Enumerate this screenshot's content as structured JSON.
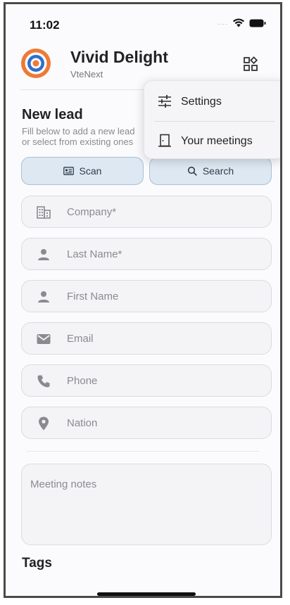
{
  "status_bar": {
    "time": "11:02",
    "signal": "....",
    "icons": [
      "wifi-icon",
      "battery-icon"
    ]
  },
  "header": {
    "title": "Vivid Delight",
    "subtitle": "VteNext",
    "logo_colors": {
      "outer": "#ee7a35",
      "inner": "#2f6fc9"
    },
    "menu_icon": "grid-icon"
  },
  "section": {
    "title": "New lead",
    "description": "Fill below to add a new lead or select from existing ones"
  },
  "actions": {
    "scan_label": "Scan",
    "scan_icon": "id-card-icon",
    "search_label": "Search",
    "search_icon": "search-icon"
  },
  "form": {
    "company": "Company*",
    "last_name": "Last Name*",
    "first_name": "First Name",
    "email": "Email",
    "phone": "Phone",
    "nation": "Nation",
    "notes": "Meeting notes"
  },
  "tags": {
    "title": "Tags"
  },
  "popup_menu": {
    "items": [
      {
        "label": "Settings",
        "icon": "sliders-icon"
      },
      {
        "label": "Your meetings",
        "icon": "door-icon"
      }
    ]
  },
  "colors": {
    "accent_pill": "#dde8f2",
    "accent_border": "#a9c1d6",
    "field_bg": "#f4f4f7",
    "icon_gray": "#8a8a8f"
  }
}
